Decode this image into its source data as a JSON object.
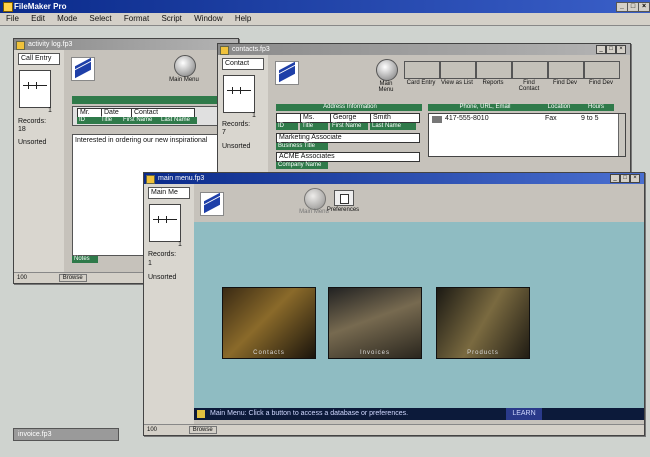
{
  "app": {
    "title": "FileMaker Pro",
    "menu": [
      "File",
      "Edit",
      "Mode",
      "Select",
      "Format",
      "Script",
      "Window",
      "Help"
    ]
  },
  "activity_window": {
    "title": "activity log.fp3",
    "layout": "Call Entry",
    "records_label": "Records:",
    "records_count": "18",
    "sort_status": "Unsorted",
    "page": "1",
    "table_headers": [
      "Mr.",
      "Date",
      "Contact"
    ],
    "table_sub_headers": [
      "ID",
      "Title",
      "First Name",
      "Last Name"
    ],
    "note_text": "Interested in ordering our new inspirational",
    "notes_label": "Notes",
    "zoom": "100",
    "mode": "Browse"
  },
  "contacts_window": {
    "title": "contacts.fp3",
    "layout": "Contact",
    "records_label": "Records:",
    "records_count": "7",
    "sort_status": "Unsorted",
    "page": "1",
    "toolbar": [
      {
        "label": "Main Menu"
      },
      {
        "label": "Card Entry"
      },
      {
        "label": "View as List"
      },
      {
        "label": "Reports"
      },
      {
        "label": "Find Contact"
      },
      {
        "label": "Find Dev"
      },
      {
        "label": "Find Dev"
      }
    ],
    "address_header": "Address Information",
    "phone_header": "Phone, URL, Email",
    "location_header": "Location",
    "hours_header": "Hours",
    "title_value": "Ms.",
    "first_name": "George",
    "last_name": "Smith",
    "labels": {
      "id": "ID",
      "title": "Title",
      "first": "First Name",
      "last": "Last Name",
      "business_title": "Business Title",
      "company": "Company Name"
    },
    "business_title": "Marketing Associate",
    "company_name": "ACME Associates",
    "phone": "417-555-8010",
    "location": "Fax",
    "hours": "9 to 5"
  },
  "main_window": {
    "title": "main menu.fp3",
    "layout": "Main Me",
    "records_label": "Records:",
    "records_count": "1",
    "sort_status": "Unsorted",
    "page": "1",
    "main_menu_label": "Main Menu",
    "preferences_label": "Preferences",
    "thumbnails": [
      "Contacts",
      "Invoices",
      "Products"
    ],
    "status_message": "Main Menu: Click a button to access a database or preferences.",
    "status_right": "LEARN",
    "zoom": "100",
    "mode": "Browse"
  },
  "minimized_window": {
    "title": "invoice.fp3"
  }
}
